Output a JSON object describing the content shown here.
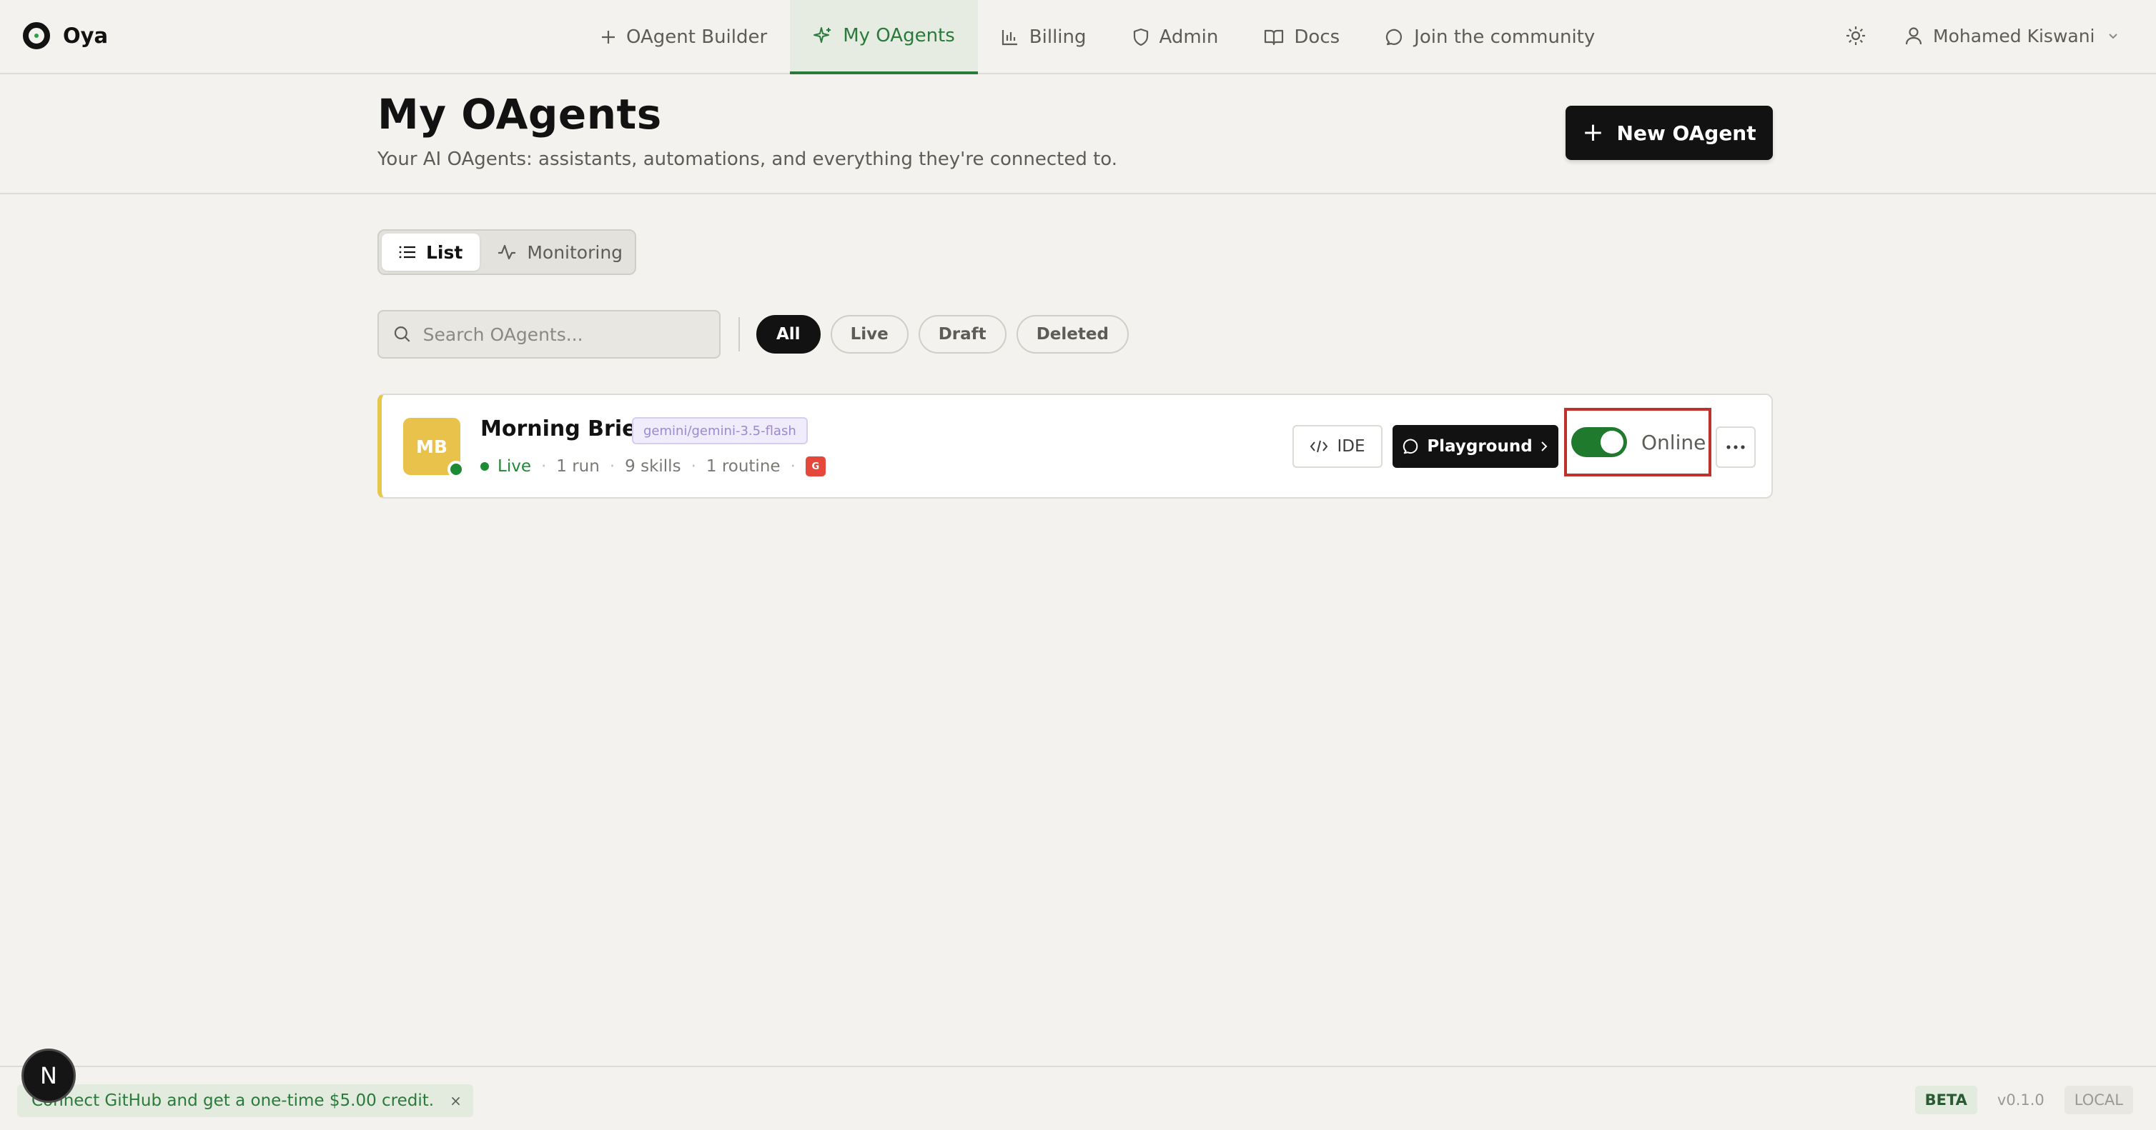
{
  "brand": {
    "name": "Oya"
  },
  "nav": {
    "links": [
      {
        "label": "OAgent Builder",
        "icon": "plus-icon"
      },
      {
        "label": "My OAgents",
        "icon": "sparkle-icon",
        "active": true
      },
      {
        "label": "Billing",
        "icon": "bar-chart-icon"
      },
      {
        "label": "Admin",
        "icon": "shield-icon"
      },
      {
        "label": "Docs",
        "icon": "book-icon"
      },
      {
        "label": "Join the community",
        "icon": "chat-bubble-icon"
      }
    ],
    "theme_icon": "sun-icon",
    "user": {
      "name": "Mohamed Kiswani",
      "icon": "user-icon"
    }
  },
  "header": {
    "title": "My OAgents",
    "subtitle": "Your AI OAgents: assistants, automations, and everything they're connected to.",
    "new_button": "New OAgent"
  },
  "view_tabs": [
    {
      "label": "List",
      "icon": "list-icon",
      "active": true
    },
    {
      "label": "Monitoring",
      "icon": "activity-icon"
    }
  ],
  "search": {
    "placeholder": "Search OAgents...",
    "value": ""
  },
  "filters": [
    {
      "label": "All",
      "active": true
    },
    {
      "label": "Live"
    },
    {
      "label": "Draft"
    },
    {
      "label": "Deleted"
    }
  ],
  "agents": [
    {
      "initials": "MB",
      "name": "Morning Brief",
      "model": "gemini/gemini-3.5-flash",
      "status": "Live",
      "runs": "1 run",
      "skills": "9 skills",
      "routines": "1 routine",
      "integration_badge": "G",
      "ide_label": "IDE",
      "playground_label": "Playground",
      "toggle_on": true,
      "toggle_label": "Online"
    }
  ],
  "footer": {
    "promo": "Connect GitHub and get a one-time $5.00 credit.",
    "promo_close": "×",
    "badge_beta": "BETA",
    "version": "v0.1.0",
    "badge_local": "LOCAL"
  },
  "dev_badge": "N",
  "colors": {
    "accent_green": "#2a7a3c",
    "toggle_green": "#1f7a2e",
    "highlight_red": "#c0312b",
    "avatar_yellow": "#e8c24a"
  }
}
